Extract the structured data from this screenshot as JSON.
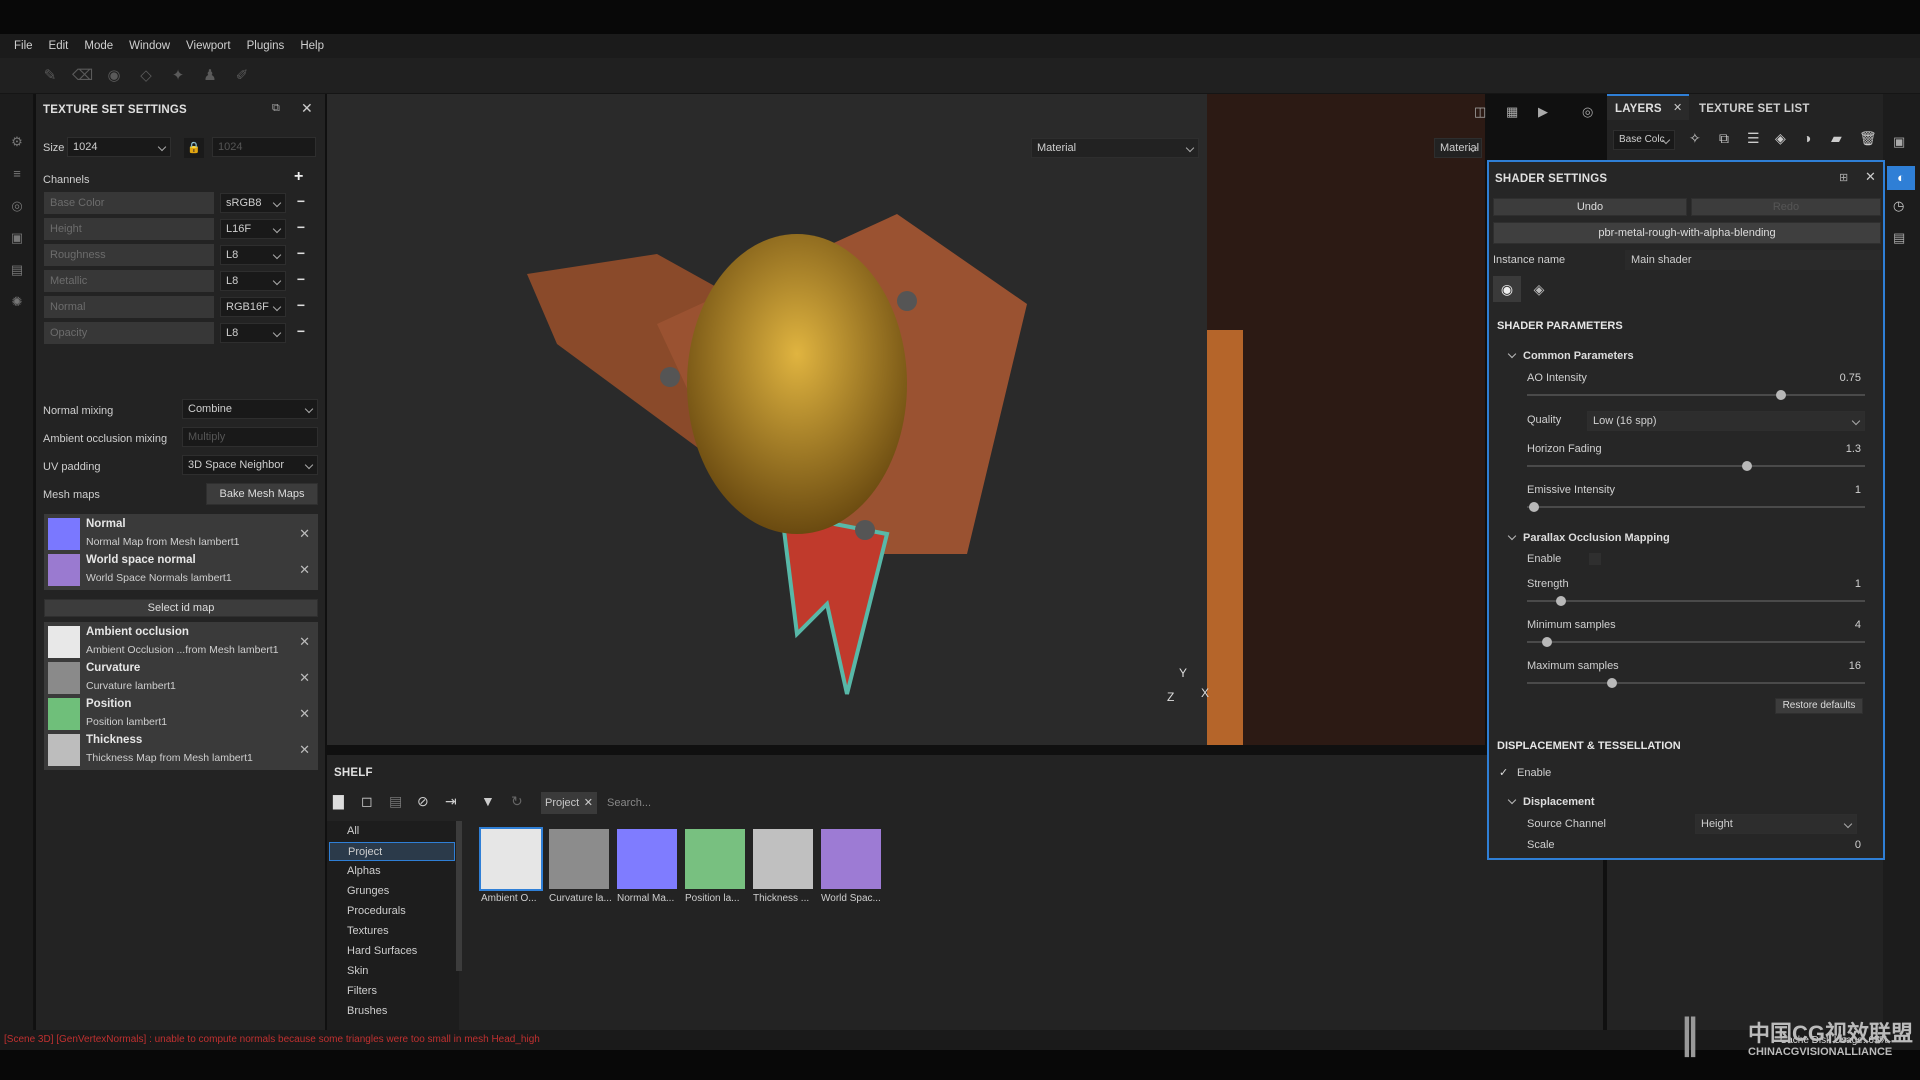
{
  "menu": [
    "File",
    "Edit",
    "Mode",
    "Window",
    "Viewport",
    "Plugins",
    "Help"
  ],
  "texture_set": {
    "title": "TEXTURE SET SETTINGS",
    "size_label": "Size",
    "size_value": "1024",
    "size_value_locked": "1024",
    "channels_label": "Channels",
    "channels": [
      {
        "name": "Base Color",
        "format": "sRGB8"
      },
      {
        "name": "Height",
        "format": "L16F"
      },
      {
        "name": "Roughness",
        "format": "L8"
      },
      {
        "name": "Metallic",
        "format": "L8"
      },
      {
        "name": "Normal",
        "format": "RGB16F"
      },
      {
        "name": "Opacity",
        "format": "L8"
      }
    ],
    "normal_mixing_label": "Normal mixing",
    "normal_mixing_value": "Combine",
    "ao_mixing_label": "Ambient occlusion mixing",
    "ao_mixing_value": "Multiply",
    "uv_padding_label": "UV padding",
    "uv_padding_value": "3D Space Neighbor",
    "mesh_maps_label": "Mesh maps",
    "bake_button": "Bake Mesh Maps",
    "select_id_map": "Select id map",
    "mesh_maps": [
      {
        "name": "Normal",
        "sub": "Normal Map from Mesh lambert1",
        "color": "#7a78ff"
      },
      {
        "name": "World space normal",
        "sub": "World Space Normals lambert1",
        "color": "#9a7ad0"
      },
      {
        "name": "Ambient occlusion",
        "sub": "Ambient Occlusion ...from Mesh lambert1",
        "color": "#e8e8e8"
      },
      {
        "name": "Curvature",
        "sub": "Curvature lambert1",
        "color": "#8a8a8a"
      },
      {
        "name": "Position",
        "sub": "Position lambert1",
        "color": "#6fbf7a"
      },
      {
        "name": "Thickness",
        "sub": "Thickness Map from Mesh lambert1",
        "color": "#bdbdbd"
      }
    ]
  },
  "viewport": {
    "material_left": "Material",
    "material_right": "Material",
    "axis_y": "Y",
    "axis_z": "Z",
    "axis_x": "X"
  },
  "shelf": {
    "title": "SHELF",
    "project_tag": "Project",
    "search_placeholder": "Search...",
    "categories": [
      "All",
      "Project",
      "Alphas",
      "Grunges",
      "Procedurals",
      "Textures",
      "Hard Surfaces",
      "Skin",
      "Filters",
      "Brushes"
    ],
    "selected_category": "Project",
    "items": [
      {
        "label": "Ambient O...",
        "color": "#e6e6e6"
      },
      {
        "label": "Curvature la...",
        "color": "#8c8c8c"
      },
      {
        "label": "Normal Ma...",
        "color": "#7f7cff"
      },
      {
        "label": "Position la...",
        "color": "#78c080"
      },
      {
        "label": "Thickness ...",
        "color": "#c0c0c0"
      },
      {
        "label": "World Spac...",
        "color": "#9d7bd4"
      }
    ]
  },
  "layers": {
    "tab_layers": "LAYERS",
    "tab_texture_set_list": "TEXTURE SET LIST",
    "channel_select": "Base Colc"
  },
  "shader": {
    "title": "SHADER SETTINGS",
    "undo": "Undo",
    "redo": "Redo",
    "shader_name": "pbr-metal-rough-with-alpha-blending",
    "instance_label": "Instance name",
    "instance_value": "Main shader",
    "params_title": "SHADER PARAMETERS",
    "common_title": "Common Parameters",
    "ao_intensity_label": "AO Intensity",
    "ao_intensity_value": "0.75",
    "ao_intensity": 0.75,
    "quality_label": "Quality",
    "quality_value": "Low (16 spp)",
    "horizon_label": "Horizon Fading",
    "horizon_value": "1.3",
    "horizon": 0.65,
    "emissive_label": "Emissive Intensity",
    "emissive_value": "1",
    "emissive": 0.02,
    "pom_title": "Parallax Occlusion Mapping",
    "enable_label": "Enable",
    "strength_label": "Strength",
    "strength_value": "1",
    "strength": 0.1,
    "min_samples_label": "Minimum samples",
    "min_samples_value": "4",
    "min_samples": 0.06,
    "max_samples_label": "Maximum samples",
    "max_samples_value": "16",
    "max_samples": 0.25,
    "restore_defaults": "Restore defaults",
    "disp_title": "DISPLACEMENT & TESSELLATION",
    "disp_enable": "Enable",
    "displacement_title": "Displacement",
    "source_label": "Source Channel",
    "source_value": "Height",
    "scale_label": "Scale",
    "scale_value": "0"
  },
  "status": {
    "error": "[Scene 3D] [GenVertexNormals] : unable to compute normals because some triangles were too small in mesh Head_high",
    "cache": "Cache Disk Usage: 65%",
    "watermark": "中国CG视效联盟",
    "watermark_sub": "CHINACGVISIONALLIANCE"
  },
  "colors": {
    "accent": "#2f7fd6",
    "error": "#c03030"
  }
}
